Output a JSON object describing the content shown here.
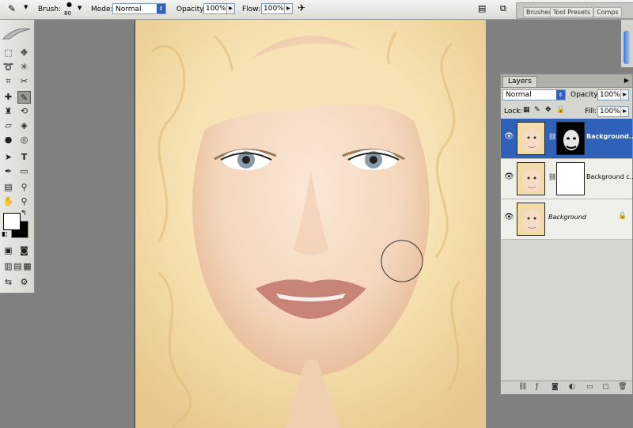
{
  "options_bar": {
    "brush_label": "Brush:",
    "brush_size": "80",
    "mode_label": "Mode:",
    "mode_value": "Normal",
    "opacity_label": "Opacity:",
    "opacity_value": "100%",
    "flow_label": "Flow:",
    "flow_value": "100%"
  },
  "panel_well": {
    "tabs": [
      "Brushes",
      "Tool Presets",
      "Comps"
    ]
  },
  "layers_panel": {
    "tab_label": "Layers",
    "blend_mode": "Normal",
    "opacity_label": "Opacity:",
    "opacity_value": "100%",
    "lock_label": "Lock:",
    "fill_label": "Fill:",
    "fill_value": "100%",
    "layers": [
      {
        "name": "Background...",
        "selected": true,
        "mask": "black"
      },
      {
        "name": "Background c...",
        "selected": false,
        "mask": "white"
      },
      {
        "name": "Background",
        "selected": false,
        "mask": "none"
      }
    ]
  },
  "colors": {
    "selection": "#2f61b8",
    "workspace": "#808080",
    "panel": "#d6d6d0"
  }
}
